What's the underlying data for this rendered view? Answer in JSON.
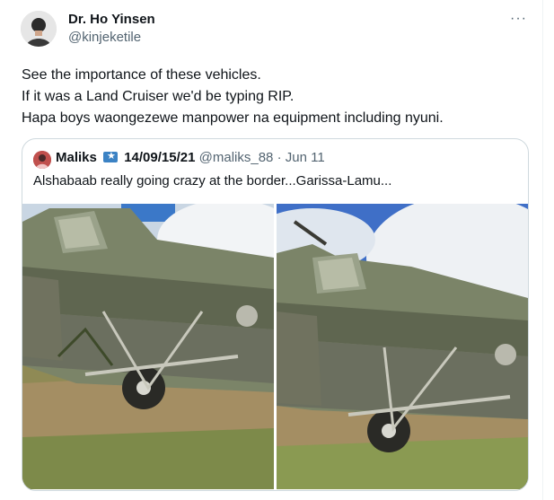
{
  "author": {
    "name": "Dr. Ho Yinsen",
    "handle": "@kinjeketile"
  },
  "more_icon": "more-horizontal-icon",
  "tweet_lines": [
    "See the importance of these vehicles.",
    "If it was a Land Cruiser we'd be typing RIP.",
    "Hapa boys waongezewe manpower na equipment including nyuni."
  ],
  "quoted": {
    "name": "Maliks",
    "badge_icon": "somalia-flag-icon",
    "bold_text": "14/09/15/21",
    "handle": "@maliks_88",
    "separator": "·",
    "date": "Jun 11",
    "text": "Alshabaab really going crazy at the border...Garissa-Lamu..."
  },
  "colors": {
    "text": "#0f1419",
    "secondary": "#536471",
    "border": "#cfd9de"
  }
}
